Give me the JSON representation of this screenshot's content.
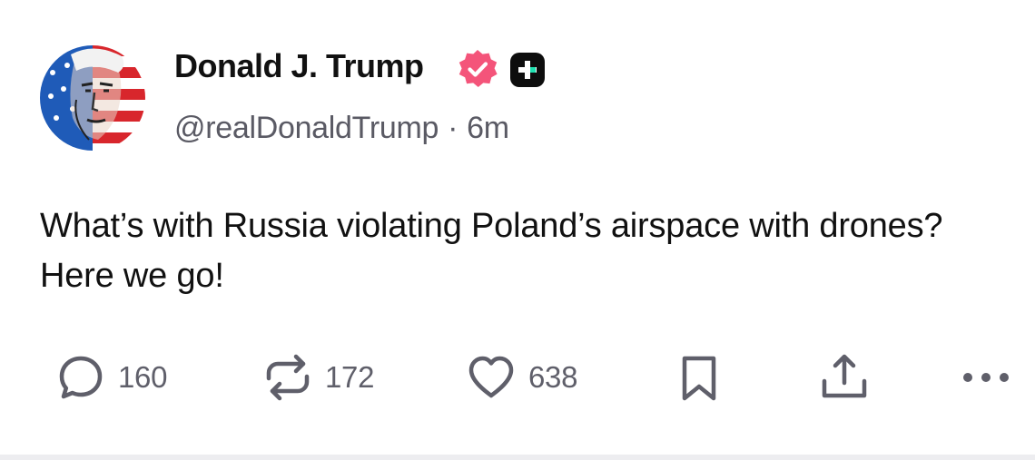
{
  "author": {
    "display_name": "Donald J. Trump",
    "handle": "@realDonaldTrump",
    "separator": "·",
    "timestamp": "6m",
    "verified_badge_color": "#f4547a",
    "avatar_icon": "portrait-flag-avatar"
  },
  "post": {
    "text": "What’s with Russia violating Poland’s airspace with drones? Here we go!"
  },
  "actions": {
    "reply": {
      "icon": "reply-icon",
      "count": "160"
    },
    "retruth": {
      "icon": "retruth-icon",
      "count": "172"
    },
    "like": {
      "icon": "heart-icon",
      "count": "638"
    },
    "bookmark": {
      "icon": "bookmark-icon"
    },
    "share": {
      "icon": "share-icon"
    },
    "more": {
      "icon": "more-icon"
    }
  },
  "colors": {
    "text_primary": "#111111",
    "text_secondary": "#5a5a64",
    "icon_gray": "#5f5f6a"
  }
}
